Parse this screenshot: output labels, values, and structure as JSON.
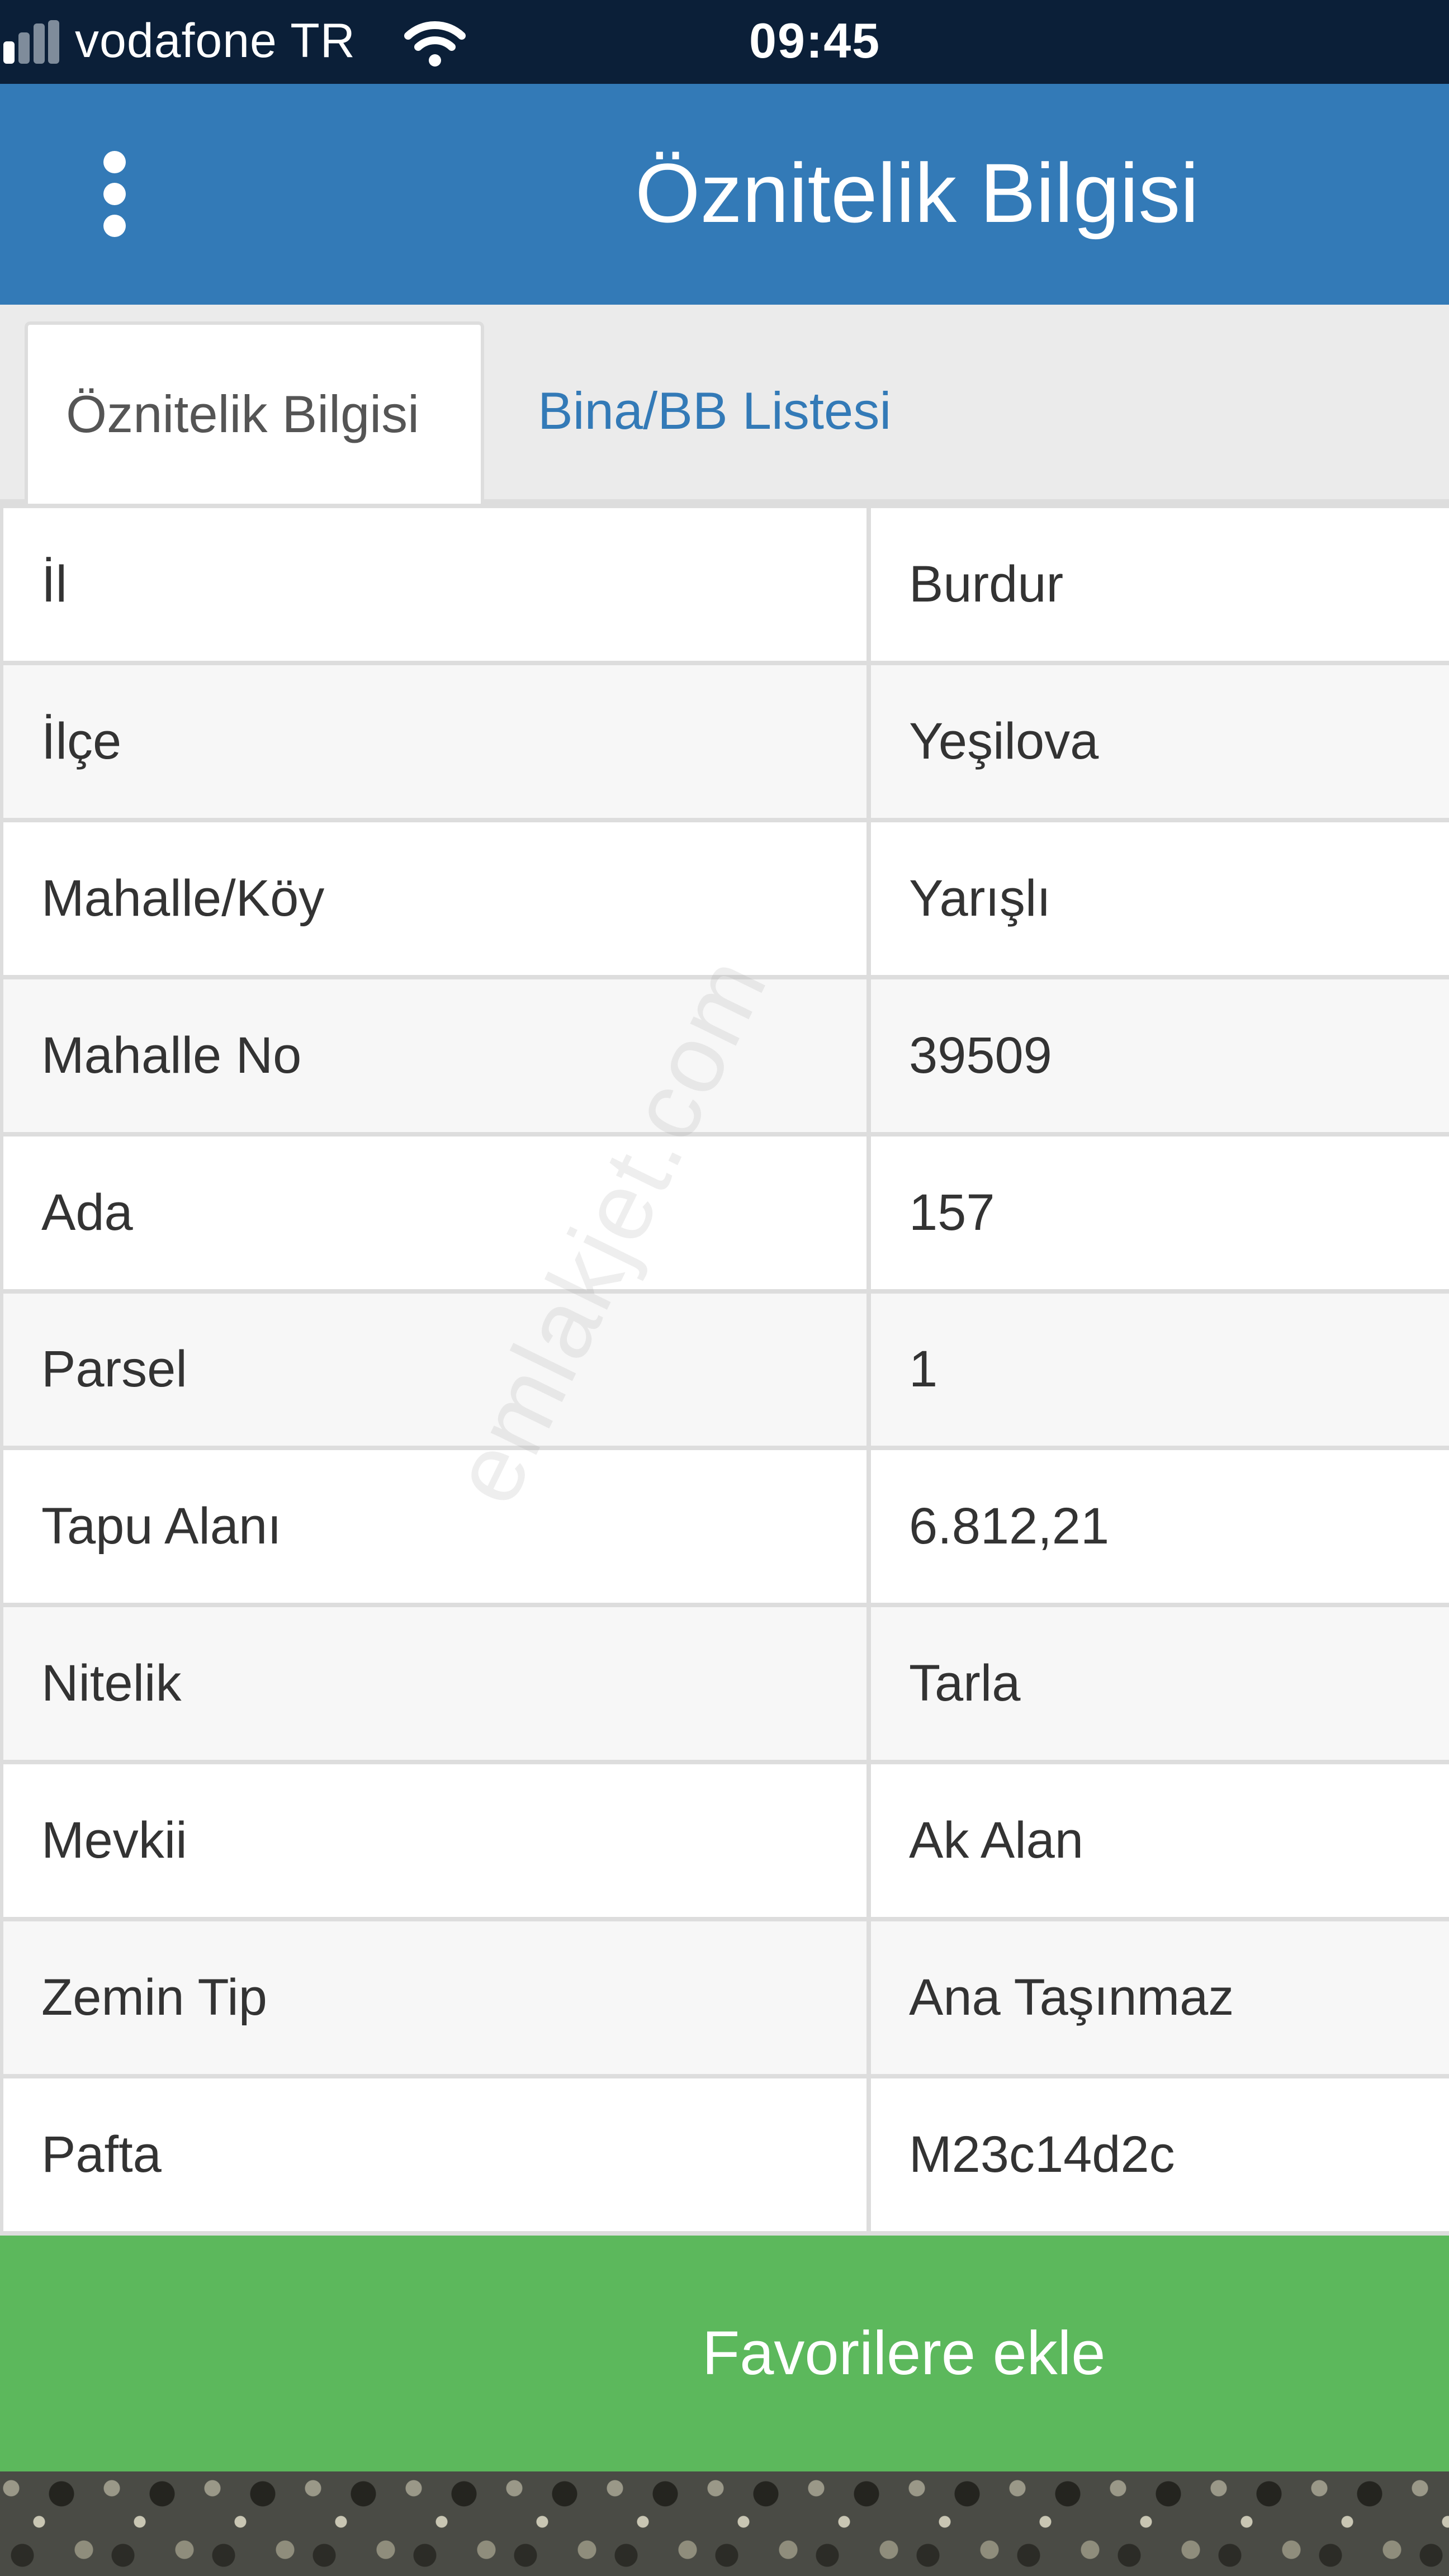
{
  "status_bar": {
    "carrier": "vodafone TR",
    "time": "09:45",
    "signal_icon": "signal-bars-icon",
    "wifi_icon": "wifi-icon"
  },
  "header": {
    "title": "Öznitelik Bilgisi",
    "menu_icon": "kebab-menu-icon",
    "background_color": "#337ab7"
  },
  "tabs": [
    {
      "label": "Öznitelik Bilgisi",
      "active": true
    },
    {
      "label": "Bina/BB Listesi",
      "active": false
    }
  ],
  "attributes": [
    {
      "label": "İl",
      "value": "Burdur"
    },
    {
      "label": "İlçe",
      "value": "Yeşilova"
    },
    {
      "label": "Mahalle/Köy",
      "value": "Yarışlı"
    },
    {
      "label": "Mahalle No",
      "value": "39509"
    },
    {
      "label": "Ada",
      "value": "157"
    },
    {
      "label": "Parsel",
      "value": "1"
    },
    {
      "label": "Tapu Alanı",
      "value": "6.812,21"
    },
    {
      "label": "Nitelik",
      "value": "Tarla"
    },
    {
      "label": "Mevkii",
      "value": "Ak Alan"
    },
    {
      "label": "Zemin Tip",
      "value": "Ana Taşınmaz"
    },
    {
      "label": "Pafta",
      "value": "M23c14d2c"
    }
  ],
  "favorite_button": {
    "label": "Favorilere ekle",
    "color": "#5cb85c"
  },
  "watermark": "emlakjet.com"
}
